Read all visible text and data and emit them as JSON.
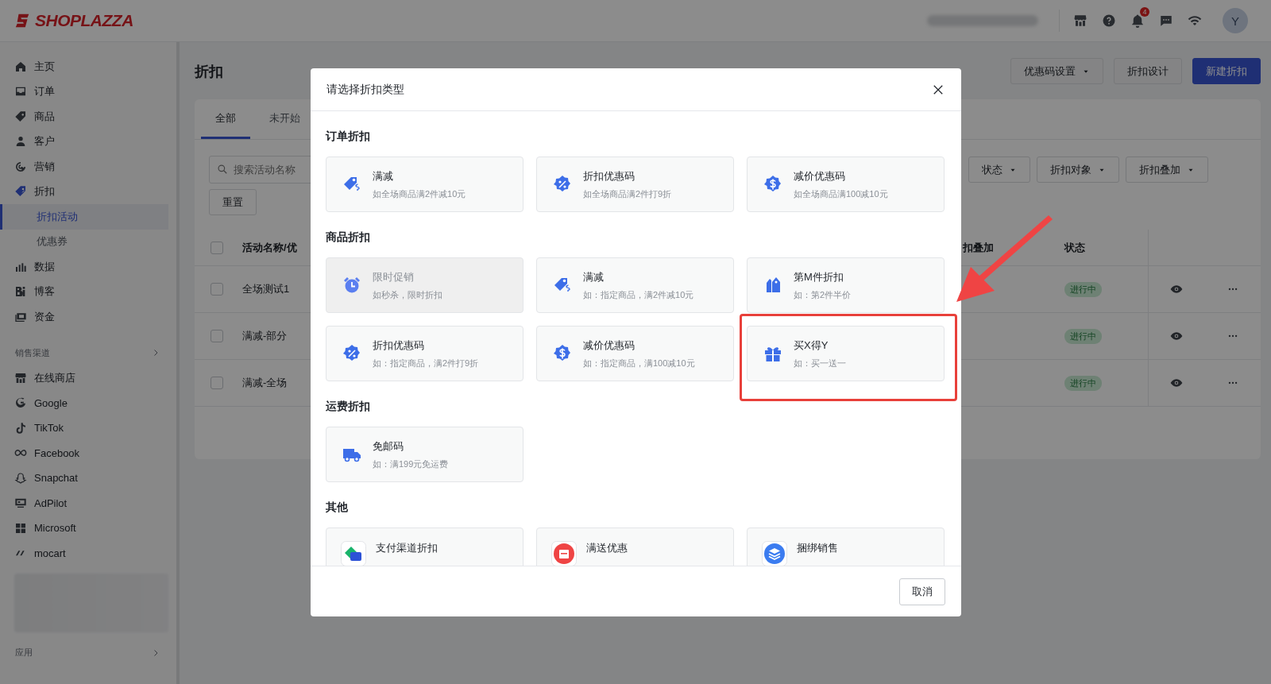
{
  "topbar": {
    "logo": "SHOPLAZZA",
    "notification_count": "4",
    "avatar": "Y"
  },
  "sidebar": {
    "items": [
      {
        "label": "主页",
        "kind": "home"
      },
      {
        "label": "订单",
        "kind": "orders"
      },
      {
        "label": "商品",
        "kind": "products"
      },
      {
        "label": "客户",
        "kind": "customers"
      },
      {
        "label": "营销",
        "kind": "marketing"
      },
      {
        "label": "折扣",
        "kind": "discount",
        "children": [
          {
            "label": "折扣活动",
            "selected": true
          },
          {
            "label": "优惠券",
            "selected": false
          }
        ]
      },
      {
        "label": "数据",
        "kind": "analytics"
      },
      {
        "label": "博客",
        "kind": "blog"
      },
      {
        "label": "资金",
        "kind": "finance"
      }
    ],
    "channels_heading": "销售渠道",
    "channels": [
      {
        "label": "在线商店",
        "kind": "store"
      },
      {
        "label": "Google",
        "kind": "google"
      },
      {
        "label": "TikTok",
        "kind": "tiktok"
      },
      {
        "label": "Facebook",
        "kind": "facebook"
      },
      {
        "label": "Snapchat",
        "kind": "snapchat"
      },
      {
        "label": "AdPilot",
        "kind": "adpilot"
      },
      {
        "label": "Microsoft",
        "kind": "microsoft"
      },
      {
        "label": "mocart",
        "kind": "mocart"
      }
    ],
    "apps_heading": "应用"
  },
  "page": {
    "title": "折扣",
    "actions": [
      {
        "label": "优惠码设置",
        "kind": "dropdown"
      },
      {
        "label": "折扣设计",
        "kind": "plain"
      },
      {
        "label": "新建折扣",
        "kind": "primary"
      }
    ],
    "tabs": [
      {
        "label": "全部",
        "selected": true
      },
      {
        "label": "未开始",
        "selected": false
      }
    ],
    "search": {
      "placeholder": "搜索活动名称"
    },
    "filters": [
      "状态",
      "折扣对象",
      "折扣叠加"
    ],
    "reset": "重置",
    "table": {
      "select_all": {
        "checked": false
      },
      "columns": [
        "活动名称/优",
        "扣叠加",
        "状态"
      ],
      "rows": [
        {
          "name": "全场测试1",
          "status": "进行中",
          "checked": false
        },
        {
          "name": "满减-部分",
          "status": "进行中",
          "checked": false
        },
        {
          "name": "满减-全场",
          "status": "进行中",
          "checked": false
        }
      ]
    }
  },
  "modal": {
    "title": "请选择折扣类型",
    "sections": [
      {
        "heading": "订单折扣",
        "cards": [
          {
            "kind": "reduction",
            "title": "满减",
            "description": "如全场商品满2件减10元",
            "disabled": false,
            "highlighted": false
          },
          {
            "kind": "percent",
            "title": "折扣优惠码",
            "description": "如全场商品满2件打9折",
            "disabled": false,
            "highlighted": false
          },
          {
            "kind": "amount",
            "title": "减价优惠码",
            "description": "如全场商品满100减10元",
            "disabled": false,
            "highlighted": false
          }
        ]
      },
      {
        "heading": "商品折扣",
        "cards": [
          {
            "kind": "flash",
            "title": "限时促销",
            "description": "如秒杀，限时折扣",
            "disabled": true,
            "highlighted": false
          },
          {
            "kind": "reduction",
            "title": "满减",
            "description": "如：指定商品，满2件减10元",
            "disabled": false,
            "highlighted": false
          },
          {
            "kind": "nth",
            "title": "第M件折扣",
            "description": "如：第2件半价",
            "disabled": false,
            "highlighted": false
          },
          {
            "kind": "percent",
            "title": "折扣优惠码",
            "description": "如：指定商品，满2件打9折",
            "disabled": false,
            "highlighted": false
          },
          {
            "kind": "amount",
            "title": "减价优惠码",
            "description": "如：指定商品，满100减10元",
            "disabled": false,
            "highlighted": false
          },
          {
            "kind": "gift",
            "title": "买X得Y",
            "description": "如：买一送一",
            "disabled": false,
            "highlighted": true
          }
        ]
      },
      {
        "heading": "运费折扣",
        "cards": [
          {
            "kind": "shipping",
            "title": "免邮码",
            "description": "如：满199元免运费",
            "disabled": false,
            "highlighted": false
          }
        ]
      },
      {
        "heading": "其他",
        "cards": [
          {
            "kind": "payment",
            "title": "支付渠道折扣",
            "disabled": false,
            "highlighted": false
          },
          {
            "kind": "present",
            "title": "满送优惠",
            "disabled": false,
            "highlighted": false
          },
          {
            "kind": "bundle",
            "title": "捆绑销售",
            "disabled": false,
            "highlighted": false
          }
        ]
      }
    ],
    "cancel": "取消"
  }
}
